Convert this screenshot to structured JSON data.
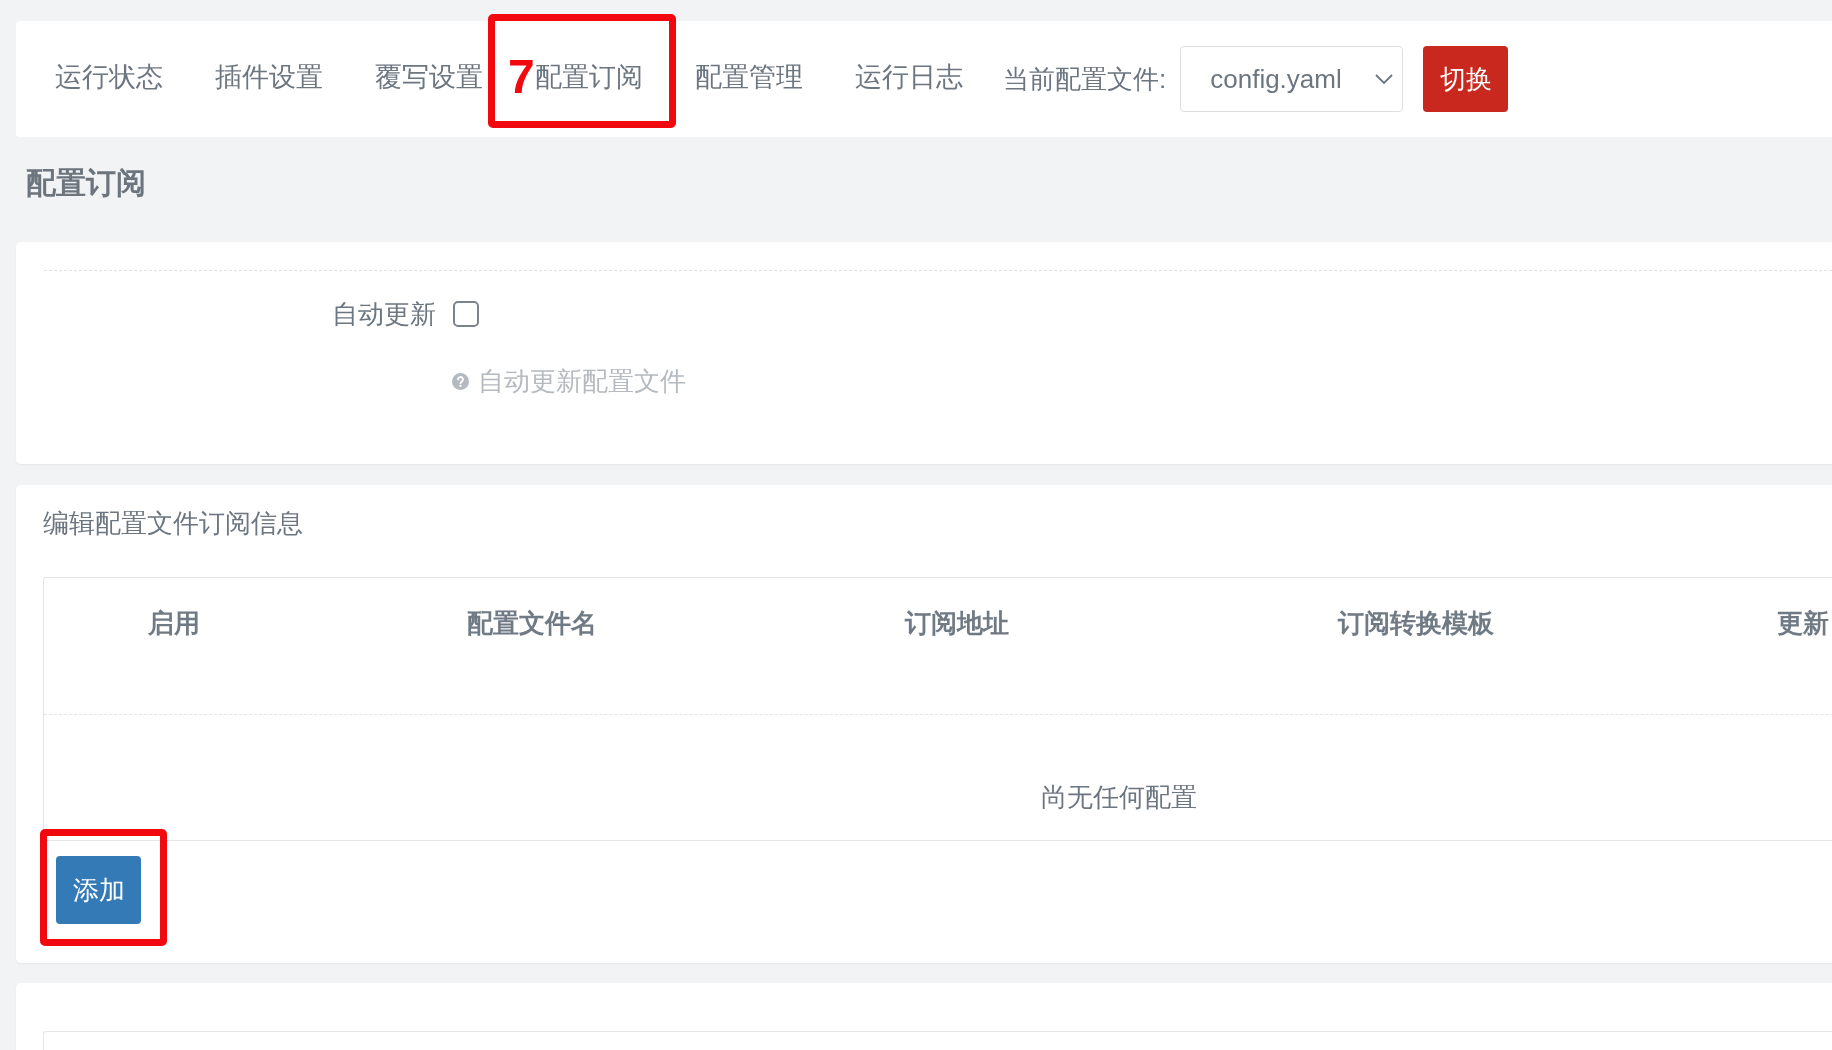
{
  "nav": {
    "tabs": [
      {
        "label": "运行状态",
        "highlighted": false
      },
      {
        "label": "插件设置",
        "highlighted": false
      },
      {
        "label": "覆写设置",
        "highlighted": false
      },
      {
        "label": "配置订阅",
        "highlighted": true,
        "callout": "7"
      },
      {
        "label": "配置管理",
        "highlighted": false
      },
      {
        "label": "运行日志",
        "highlighted": false
      }
    ],
    "config_file": {
      "label": "当前配置文件:",
      "value": "config.yaml"
    },
    "switch_button": {
      "label": "切换"
    }
  },
  "page_title": "配置订阅",
  "auto_update": {
    "label": "自动更新",
    "checked": false,
    "help": "自动更新配置文件"
  },
  "subscriptions": {
    "title": "编辑配置文件订阅信息",
    "table": {
      "columns": [
        "启用",
        "配置文件名",
        "订阅地址",
        "订阅转换模板",
        "更新"
      ],
      "empty_text": "尚无任何配置"
    },
    "add_button": {
      "label": "添加",
      "highlighted": true
    }
  }
}
